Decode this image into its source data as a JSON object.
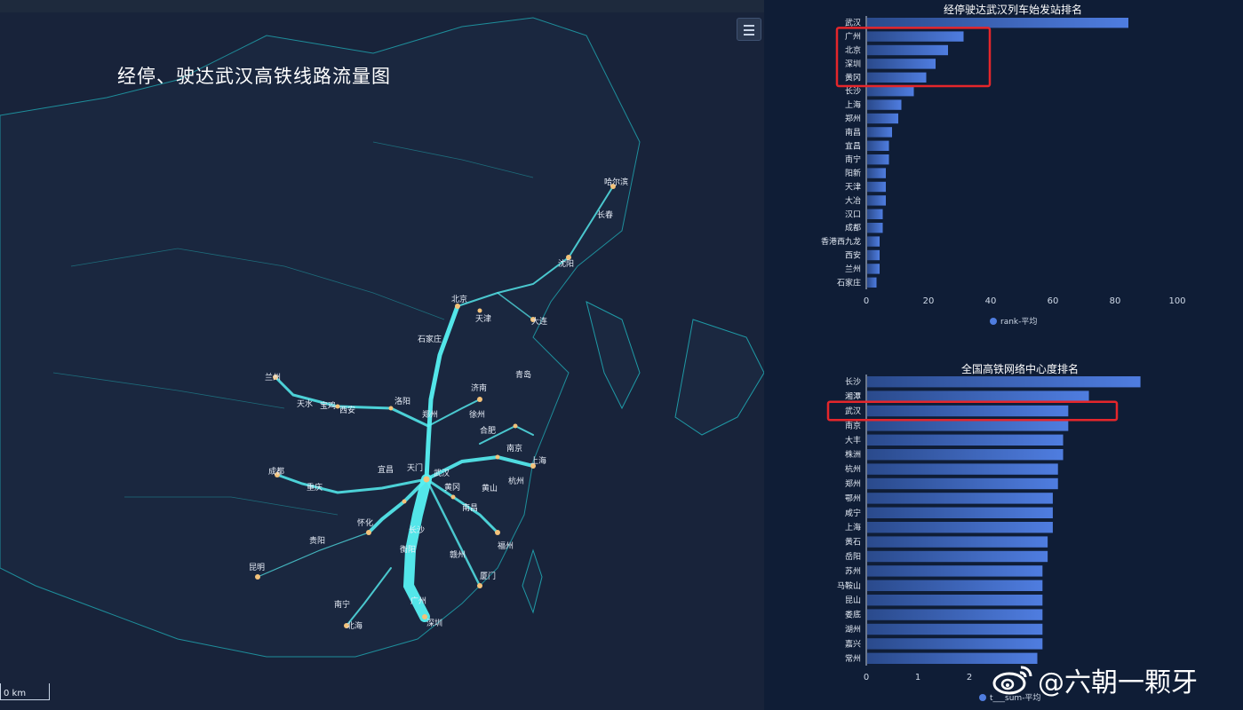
{
  "map": {
    "title": "经停、驶达武汉高铁线路流量图",
    "scale_label": "0 km",
    "menu_icon": "hamburger-menu-icon",
    "cities": [
      {
        "name": "北京",
        "bright": true
      },
      {
        "name": "天津",
        "bright": false
      },
      {
        "name": "石家庄",
        "bright": false
      },
      {
        "name": "郑州",
        "bright": true
      },
      {
        "name": "西安",
        "bright": true
      },
      {
        "name": "兰州",
        "bright": true
      },
      {
        "name": "成都",
        "bright": true
      },
      {
        "name": "重庆",
        "bright": true
      },
      {
        "name": "武汉",
        "bright": true
      },
      {
        "name": "长沙",
        "bright": true
      },
      {
        "name": "南昌",
        "bright": true
      },
      {
        "name": "合肥",
        "bright": true
      },
      {
        "name": "南京",
        "bright": true
      },
      {
        "name": "上海",
        "bright": true
      },
      {
        "name": "杭州",
        "bright": true
      },
      {
        "name": "福州",
        "bright": true
      },
      {
        "name": "广州",
        "bright": true
      },
      {
        "name": "深圳",
        "bright": true
      },
      {
        "name": "昆明",
        "bright": true
      },
      {
        "name": "贵阳",
        "bright": true
      },
      {
        "name": "南宁",
        "bright": true
      },
      {
        "name": "沈阳",
        "bright": true
      },
      {
        "name": "哈尔滨",
        "bright": true
      },
      {
        "name": "长春",
        "bright": true
      },
      {
        "name": "青岛",
        "bright": true
      },
      {
        "name": "济南",
        "bright": true
      },
      {
        "name": "大连",
        "bright": true
      },
      {
        "name": "厦门",
        "bright": true
      },
      {
        "name": "怀化",
        "bright": true
      },
      {
        "name": "宜昌",
        "bright": true
      },
      {
        "name": "天门",
        "bright": true
      },
      {
        "name": "黄冈",
        "bright": true
      },
      {
        "name": "宝鸡",
        "bright": true
      },
      {
        "name": "天水",
        "bright": true
      },
      {
        "name": "洛阳",
        "bright": true
      },
      {
        "name": "徐州",
        "bright": true
      },
      {
        "name": "黄山",
        "bright": true
      },
      {
        "name": "衡阳",
        "bright": true
      },
      {
        "name": "赣州",
        "bright": true
      },
      {
        "name": "北海",
        "bright": true
      }
    ]
  },
  "chart_data": [
    {
      "type": "bar",
      "orientation": "horizontal",
      "title": "经停驶达武汉列车始发站排名",
      "categories": [
        "武汉",
        "广州",
        "北京",
        "深圳",
        "黄冈",
        "长沙",
        "上海",
        "郑州",
        "南昌",
        "宜昌",
        "南宁",
        "阳新",
        "天津",
        "大冶",
        "汉口",
        "成都",
        "香港西九龙",
        "西安",
        "兰州",
        "石家庄"
      ],
      "values": [
        84,
        31,
        26,
        22,
        19,
        15,
        11,
        10,
        8,
        7,
        7,
        6,
        6,
        6,
        5,
        5,
        4,
        4,
        4,
        3
      ],
      "xlim": [
        0,
        100
      ],
      "xticks": [
        "0",
        "20",
        "40",
        "60",
        "80",
        "100"
      ],
      "legend": "rank-平均",
      "highlight_categories": [
        "广州",
        "北京",
        "深圳",
        "黄冈"
      ],
      "bar_color": "#4f7de0"
    },
    {
      "type": "bar",
      "orientation": "horizontal",
      "title": "全国高铁网络中心度排名",
      "categories": [
        "长沙",
        "湘潭",
        "武汉",
        "南京",
        "大丰",
        "株洲",
        "杭州",
        "郑州",
        "鄂州",
        "咸宁",
        "上海",
        "黄石",
        "岳阳",
        "苏州",
        "马鞍山",
        "昆山",
        "娄底",
        "湖州",
        "嘉兴",
        "常州"
      ],
      "values": [
        5.3,
        4.3,
        3.9,
        3.9,
        3.8,
        3.8,
        3.7,
        3.7,
        3.6,
        3.6,
        3.6,
        3.5,
        3.5,
        3.4,
        3.4,
        3.4,
        3.4,
        3.4,
        3.4,
        3.3
      ],
      "xlim": [
        0,
        5.6
      ],
      "xticks": [
        "0",
        "1",
        "2"
      ],
      "legend": "t___sum-平均",
      "highlight_categories": [
        "武汉"
      ],
      "bar_color": "#4f7de0"
    }
  ],
  "watermark": {
    "icon": "weibo-icon",
    "text": "@六朝一颗牙"
  }
}
